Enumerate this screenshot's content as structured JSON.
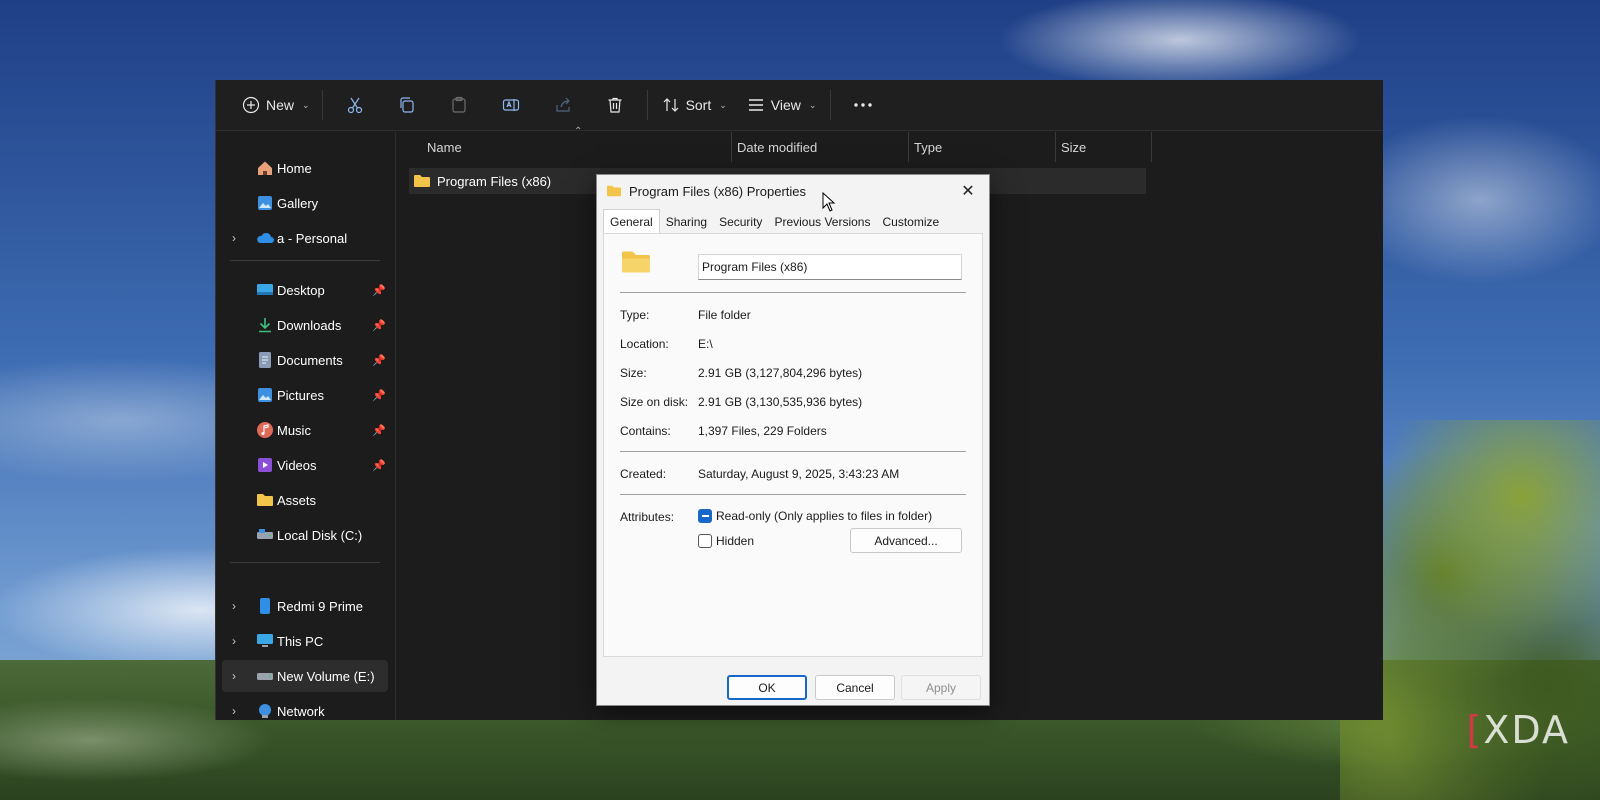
{
  "toolbar": {
    "new_label": "New",
    "sort_label": "Sort",
    "view_label": "View"
  },
  "sidebar": {
    "items": [
      {
        "label": "Home",
        "icon": "home-icon"
      },
      {
        "label": "Gallery",
        "icon": "gallery-icon"
      },
      {
        "label": "a - Personal",
        "icon": "onedrive-icon",
        "expandable": true
      },
      {
        "label": "Desktop",
        "icon": "desktop-icon",
        "pinned": true
      },
      {
        "label": "Downloads",
        "icon": "downloads-icon",
        "pinned": true
      },
      {
        "label": "Documents",
        "icon": "documents-icon",
        "pinned": true
      },
      {
        "label": "Pictures",
        "icon": "pictures-icon",
        "pinned": true
      },
      {
        "label": "Music",
        "icon": "music-icon",
        "pinned": true
      },
      {
        "label": "Videos",
        "icon": "videos-icon",
        "pinned": true
      },
      {
        "label": "Assets",
        "icon": "folder-icon"
      },
      {
        "label": "Local Disk (C:)",
        "icon": "drive-icon"
      },
      {
        "label": "Redmi 9 Prime",
        "icon": "phone-icon",
        "expandable": true
      },
      {
        "label": "This PC",
        "icon": "pc-icon",
        "expandable": true
      },
      {
        "label": "New Volume (E:)",
        "icon": "drive-icon",
        "expandable": true,
        "selected": true
      },
      {
        "label": "Network",
        "icon": "network-icon",
        "expandable": true
      }
    ]
  },
  "columns": {
    "name": "Name",
    "date": "Date modified",
    "type": "Type",
    "size": "Size"
  },
  "files": [
    {
      "name": "Program Files (x86)"
    }
  ],
  "dialog": {
    "title": "Program Files (x86) Properties",
    "tabs": [
      "General",
      "Sharing",
      "Security",
      "Previous Versions",
      "Customize"
    ],
    "folder_name": "Program Files (x86)",
    "props": {
      "type_label": "Type:",
      "type_value": "File folder",
      "location_label": "Location:",
      "location_value": "E:\\",
      "size_label": "Size:",
      "size_value": "2.91 GB (3,127,804,296 bytes)",
      "size_on_disk_label": "Size on disk:",
      "size_on_disk_value": "2.91 GB (3,130,535,936 bytes)",
      "contains_label": "Contains:",
      "contains_value": "1,397 Files, 229 Folders",
      "created_label": "Created:",
      "created_value": "Saturday, August 9, 2025, 3:43:23 AM",
      "attributes_label": "Attributes:",
      "readonly_label": "Read-only (Only applies to files in folder)",
      "hidden_label": "Hidden",
      "advanced_label": "Advanced..."
    },
    "buttons": {
      "ok": "OK",
      "cancel": "Cancel",
      "apply": "Apply"
    }
  },
  "watermark": {
    "bracket": "[",
    "text": "XDA"
  },
  "colors": {
    "accent": "#1868c9",
    "explorer_bg": "#1c1c1c",
    "dialog_bg": "#f3f3f3"
  }
}
